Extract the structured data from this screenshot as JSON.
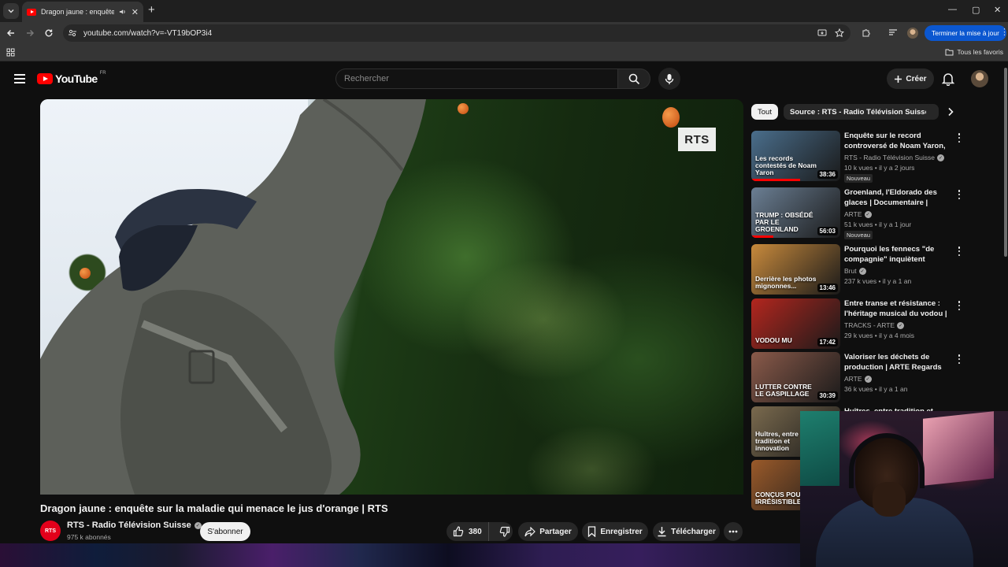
{
  "browser": {
    "tab_title": "Dragon jaune : enquête sur",
    "url": "youtube.com/watch?v=-VT19bOP3i4",
    "update_button": "Terminer la mise à jour",
    "bookmarks_right": "Tous les favoris"
  },
  "header": {
    "logo_text": "YouTube",
    "region": "FR",
    "search_placeholder": "Rechercher",
    "create_label": "Créer"
  },
  "video": {
    "watermark": "RTS",
    "title": "Dragon jaune : enquête sur la maladie qui menace le jus d'orange | RTS",
    "channel_avatar_text": "RTS",
    "channel": "RTS - Radio Télévision Suisse",
    "subscribers": "975 k abonnés",
    "subscribe_label": "S'abonner",
    "likes": "380",
    "share_label": "Partager",
    "save_label": "Enregistrer",
    "download_label": "Télécharger"
  },
  "chips": [
    "Tout",
    "Source : RTS - Radio Télévision Suisse"
  ],
  "recommendations": [
    {
      "title": "Enquête sur le record controversé de Noam Yaron, ...",
      "channel": "RTS - Radio Télévision Suisse",
      "meta": "10 k vues • il y a 2 jours",
      "badge": "Nouveau",
      "duration": "38:36",
      "thumb_text": "Les records contestés de Noam Yaron",
      "thumb_bg": "#4a6e8c"
    },
    {
      "title": "Groenland, l'Eldorado des glaces | Documentaire | ARTE",
      "channel": "ARTE",
      "meta": "51 k vues • il y a 1 jour",
      "badge": "Nouveau",
      "duration": "56:03",
      "thumb_text": "TRUMP : OBSÉDÉ PAR LE GROENLAND",
      "thumb_bg": "#6b7f94"
    },
    {
      "title": "Pourquoi les fennecs \"de compagnie\" inquiètent",
      "channel": "Brut",
      "meta": "237 k vues • il y a 1 an",
      "badge": "",
      "duration": "13:46",
      "thumb_text": "Derrière les photos mignonnes...",
      "thumb_bg": "#c88a3c"
    },
    {
      "title": "Entre transe et résistance : l'héritage musical du vodou | ...",
      "channel": "TRACKS - ARTE",
      "meta": "29 k vues • il y a 4 mois",
      "badge": "",
      "duration": "17:42",
      "thumb_text": "VODOU MU",
      "thumb_bg": "#b3261e"
    },
    {
      "title": "Valoriser les déchets de production | ARTE Regards",
      "channel": "ARTE",
      "meta": "36 k vues • il y a 1 an",
      "badge": "",
      "duration": "30:39",
      "thumb_text": "LUTTER CONTRE LE GASPILLAGE",
      "thumb_bg": "#8a5a4a"
    },
    {
      "title": "Huîtres, entre tradition et ...",
      "channel": "",
      "meta": "",
      "badge": "",
      "duration": "",
      "thumb_text": "Huîtres, entre tradition et innovation",
      "thumb_bg": "#7a6a4e"
    },
    {
      "title": "",
      "channel": "",
      "meta": "",
      "badge": "",
      "duration": "",
      "thumb_text": "CONÇUS POUR IRRÉSISTIBLES",
      "thumb_bg": "#9a5a2a"
    }
  ],
  "colors": {
    "accent_red": "#ff0000",
    "update_blue": "#0b57d0",
    "background": "#0f0f0f"
  }
}
